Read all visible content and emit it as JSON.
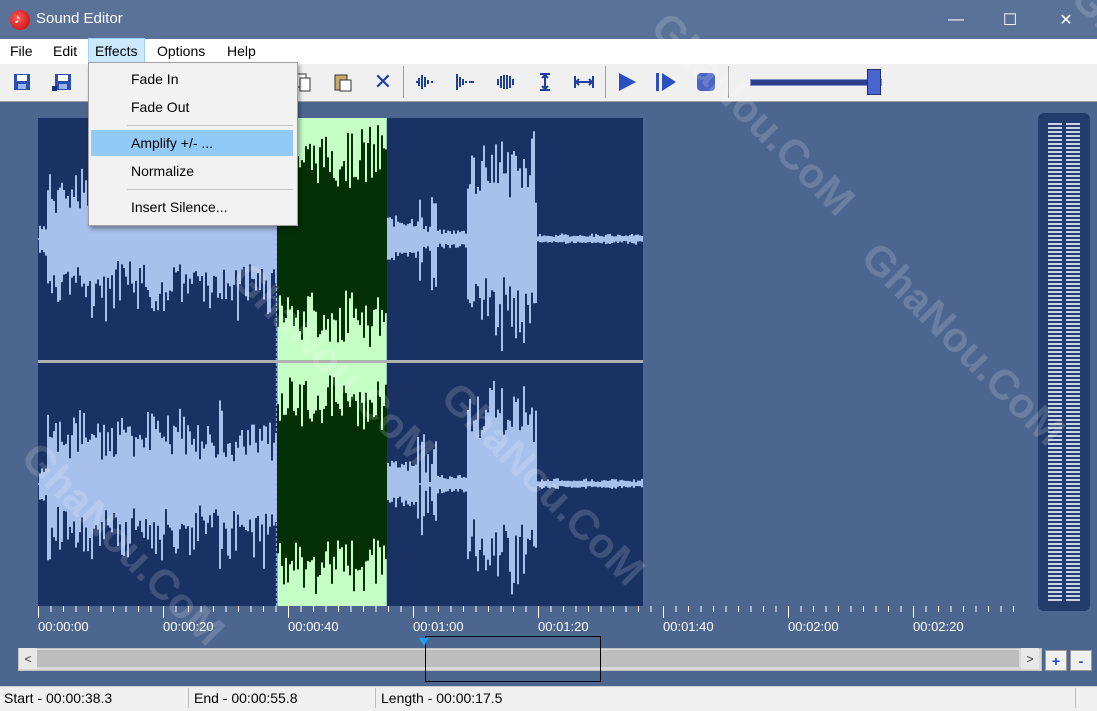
{
  "window": {
    "title": "Sound Editor",
    "controls": {
      "minimize": "—",
      "maximize": "☐",
      "close": "✕"
    }
  },
  "menubar": {
    "file": "File",
    "edit": "Edit",
    "effects": "Effects",
    "options": "Options",
    "help": "Help"
  },
  "effects_menu": {
    "fade_in": "Fade In",
    "fade_out": "Fade Out",
    "amplify": "Amplify +/- ...",
    "normalize": "Normalize",
    "insert_silence": "Insert Silence..."
  },
  "toolbar": {
    "icons": [
      "save-icon",
      "save-as-icon",
      "copy-icon",
      "paste-icon",
      "delete-icon",
      "amplify-wave-icon",
      "fade-wave-icon",
      "normalize-wave-icon",
      "vertical-zoom-icon",
      "horizontal-zoom-icon",
      "play-icon",
      "play-selection-icon",
      "stop-icon"
    ],
    "volume_level": 0.93
  },
  "timeline": {
    "labels": [
      "00:00:00",
      "00:00:20",
      "00:00:40",
      "00:01:00",
      "00:01:20",
      "00:01:40",
      "00:02:00",
      "00:02:20"
    ],
    "selection_start_s": 38.3,
    "selection_end_s": 55.8
  },
  "scroll": {
    "left_arrow": "<",
    "right_arrow": ">",
    "zoom_in": "+",
    "zoom_out": "-"
  },
  "status": {
    "start": "Start - 00:00:38.3",
    "end": "End - 00:00:55.8",
    "length": "Length - 00:00:17.5"
  },
  "watermark": "GhaNou.CoM",
  "colors": {
    "background": "#4d6690",
    "wave_bg": "#1a3263",
    "wave": "#a8c0ec",
    "selection_bg": "#c6ffc6",
    "selection_wave": "#053005",
    "menu_highlight": "#91c9f7"
  }
}
